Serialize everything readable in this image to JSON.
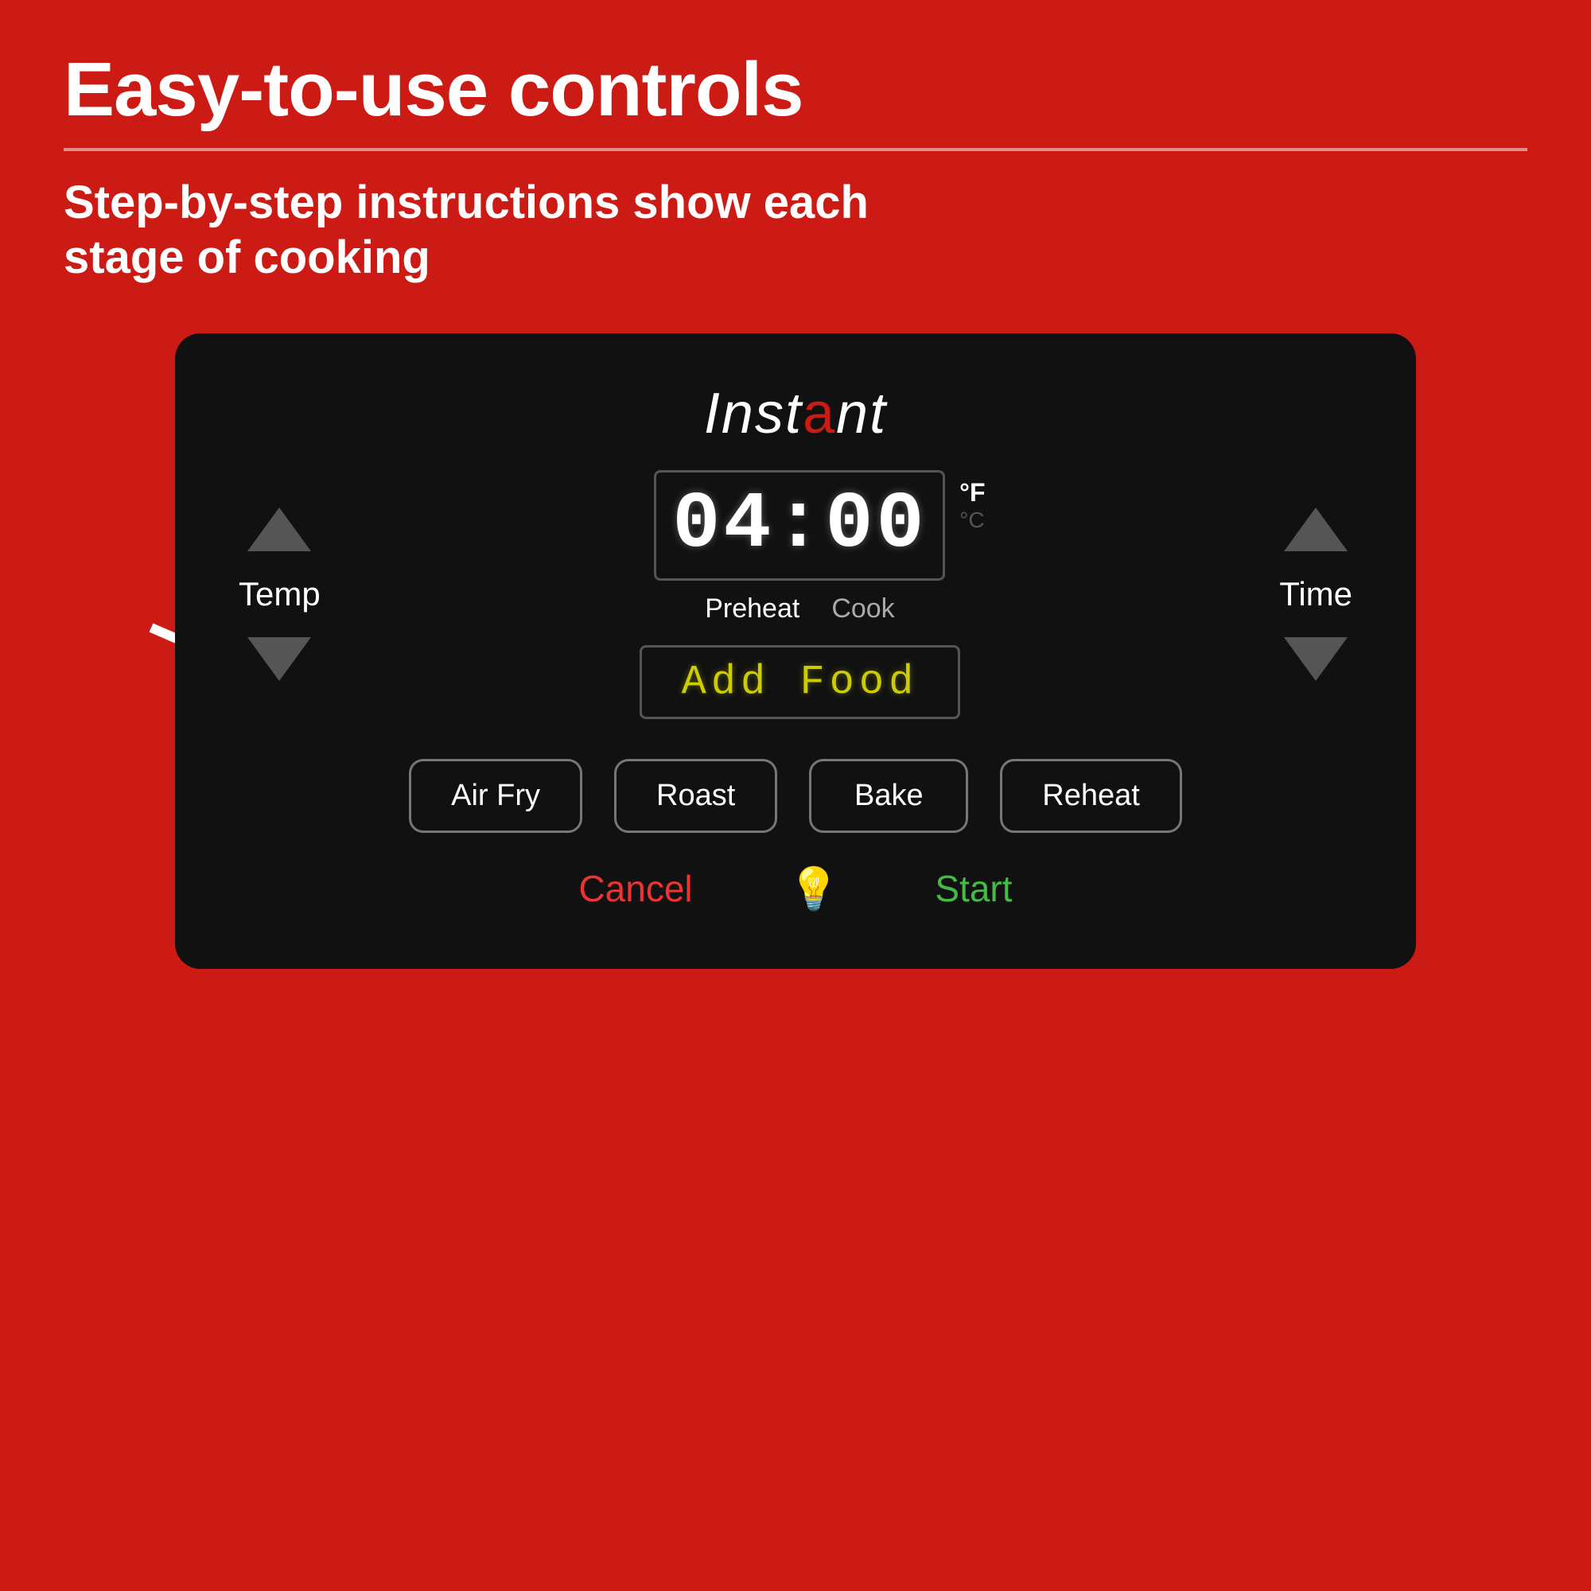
{
  "page": {
    "background_color": "#cc1a14",
    "main_title": "Easy-to-use controls",
    "subtitle": "Step-by-step instructions show each stage of cooking"
  },
  "brand": {
    "logo_text": "Instant",
    "logo_dot_char": "a"
  },
  "display": {
    "time_value": "04:00",
    "temp_unit_f": "°F",
    "temp_unit_c": "°C",
    "preheat_label": "Preheat",
    "cook_label": "Cook",
    "add_food_text": "Add  Food"
  },
  "controls": {
    "temp_label": "Temp",
    "time_label": "Time"
  },
  "mode_buttons": [
    {
      "label": "Air Fry",
      "id": "air-fry"
    },
    {
      "label": "Roast",
      "id": "roast"
    },
    {
      "label": "Bake",
      "id": "bake"
    },
    {
      "label": "Reheat",
      "id": "reheat"
    }
  ],
  "bottom_controls": {
    "cancel_label": "Cancel",
    "start_label": "Start",
    "light_icon": "💡"
  }
}
